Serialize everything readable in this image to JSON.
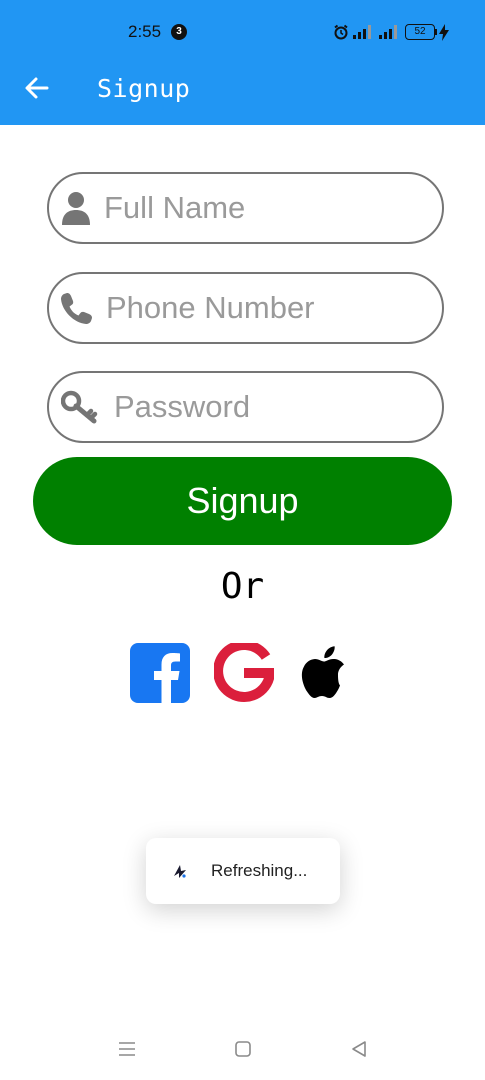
{
  "status_bar": {
    "time": "2:55",
    "notification_count": "3",
    "battery_level": "52"
  },
  "app_bar": {
    "title": "Signup",
    "background_color": "#2196f3"
  },
  "form": {
    "full_name": {
      "placeholder": "Full Name",
      "value": "",
      "icon": "user-icon"
    },
    "phone": {
      "placeholder": "Phone Number",
      "value": "",
      "icon": "phone-icon"
    },
    "password": {
      "placeholder": "Password",
      "value": "",
      "icon": "key-icon"
    },
    "submit_label": "Signup",
    "submit_color": "#008000"
  },
  "divider_text": "Or",
  "social_logins": [
    {
      "name": "facebook",
      "icon": "facebook-icon",
      "color": "#1877f2"
    },
    {
      "name": "google",
      "icon": "google-icon",
      "color": "#db1f3c"
    },
    {
      "name": "apple",
      "icon": "apple-icon",
      "color": "#000000"
    }
  ],
  "toast": {
    "text": "Refreshing..."
  },
  "nav_bar": {
    "icons": [
      "menu-icon",
      "home-icon",
      "back-triangle-icon"
    ]
  }
}
